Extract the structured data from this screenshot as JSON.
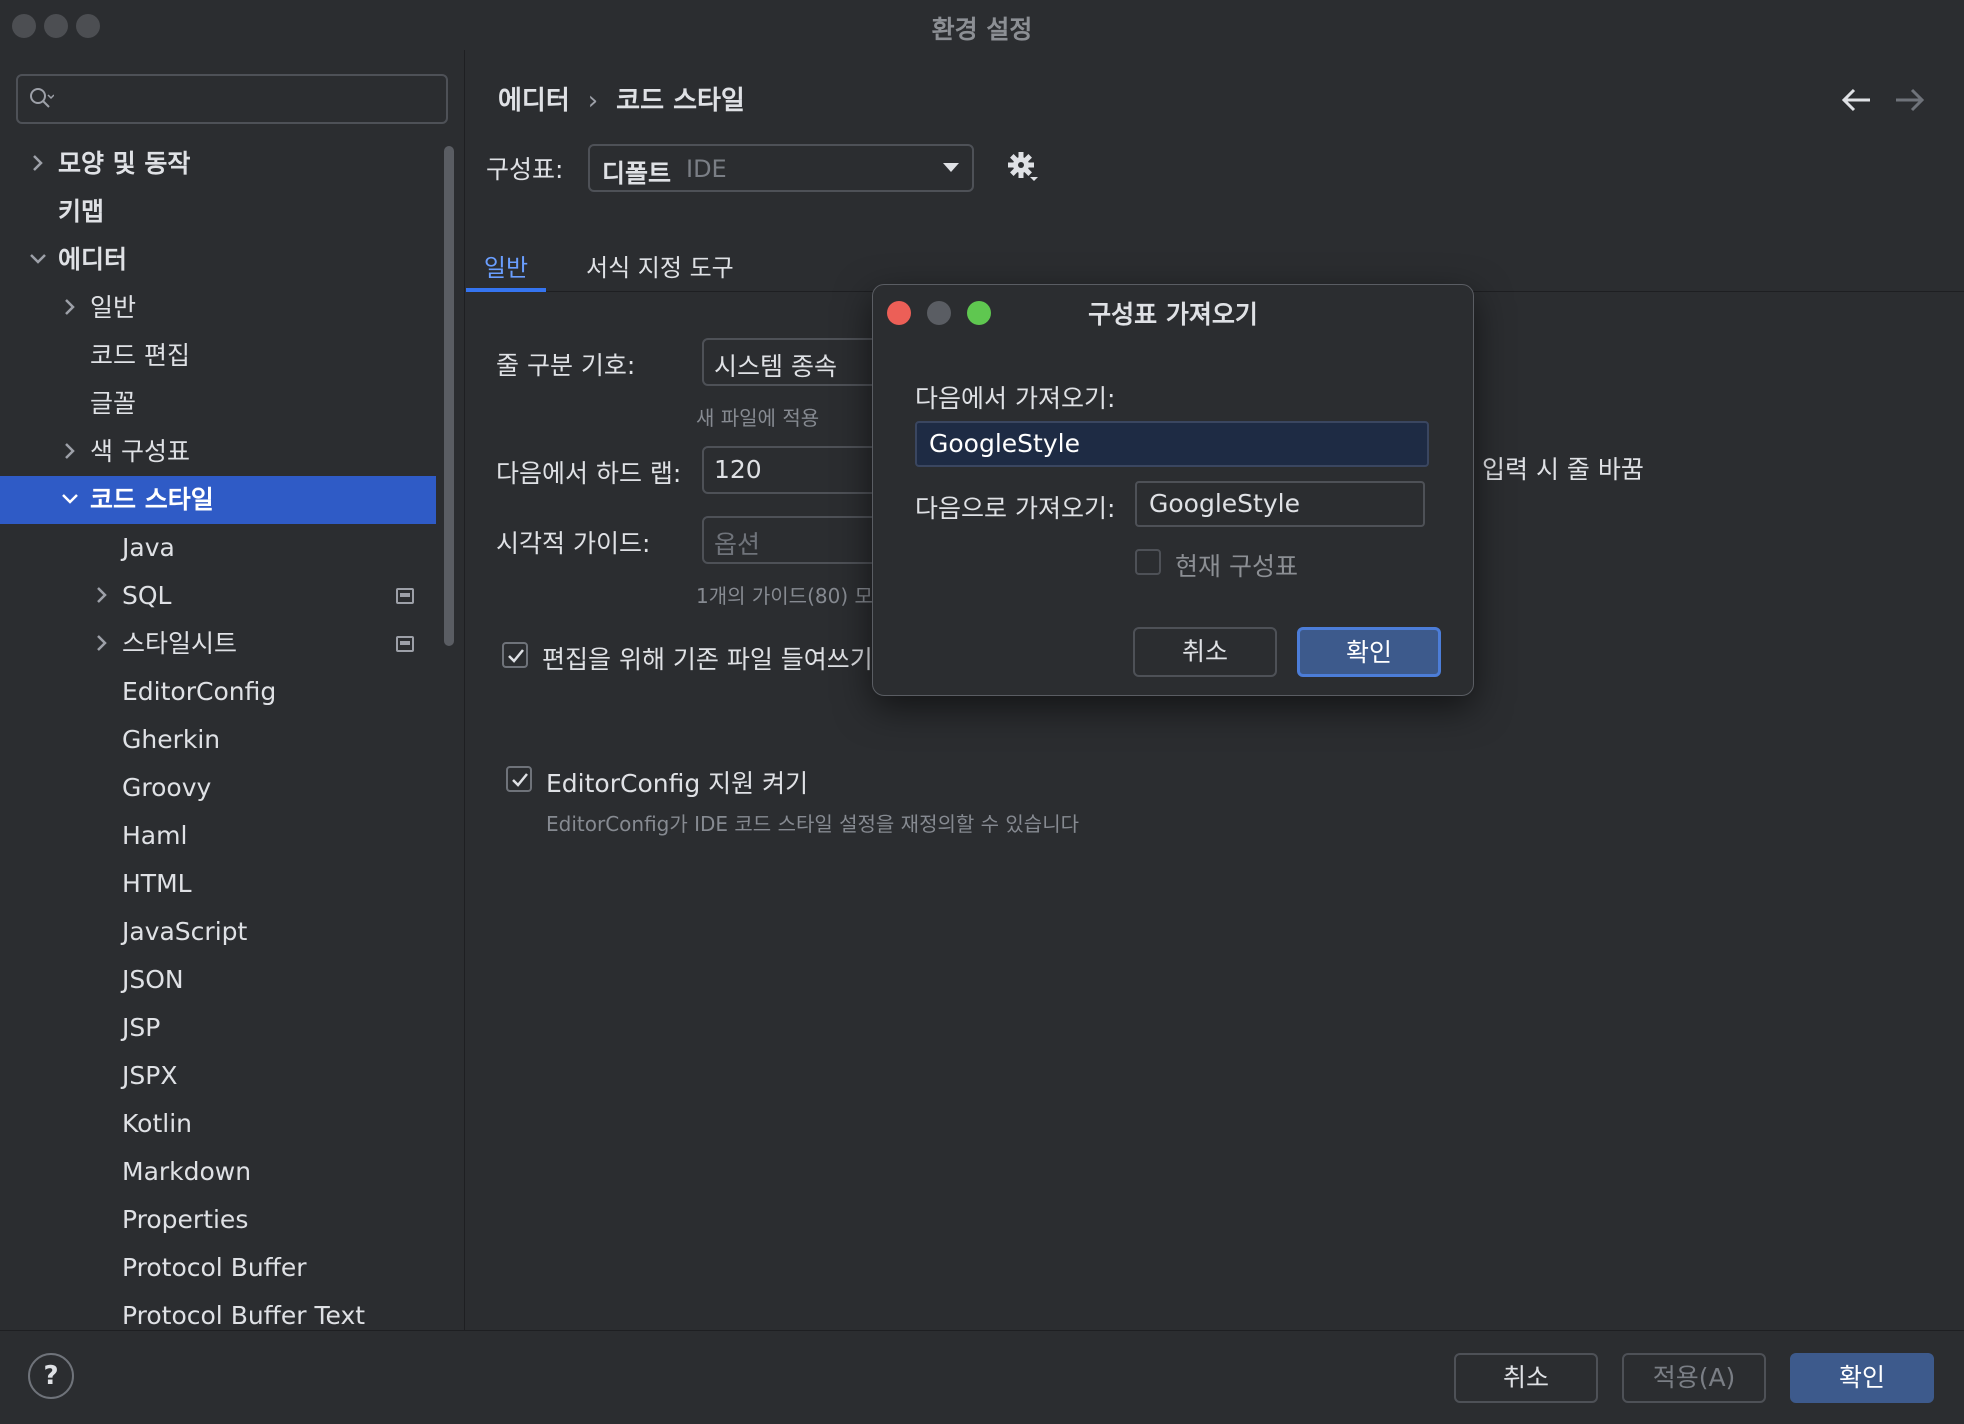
{
  "window": {
    "title": "환경 설정"
  },
  "sidebar": {
    "search": {
      "placeholder": ""
    },
    "items": [
      {
        "label": "모양 및 동작",
        "level": 0,
        "chevron": "right",
        "bold": true
      },
      {
        "label": "키맵",
        "level": 0,
        "chevron": "none",
        "bold": true
      },
      {
        "label": "에디터",
        "level": 0,
        "chevron": "down",
        "bold": true
      },
      {
        "label": "일반",
        "level": 1,
        "chevron": "right"
      },
      {
        "label": "코드 편집",
        "level": 1,
        "chevron": "none"
      },
      {
        "label": "글꼴",
        "level": 1,
        "chevron": "none"
      },
      {
        "label": "색 구성표",
        "level": 1,
        "chevron": "right"
      },
      {
        "label": "코드 스타일",
        "level": 1,
        "chevron": "down",
        "selected": true
      },
      {
        "label": "Java",
        "level": 2,
        "chevron": "none"
      },
      {
        "label": "SQL",
        "level": 2,
        "chevron": "right",
        "project_icon": true
      },
      {
        "label": "스타일시트",
        "level": 2,
        "chevron": "right",
        "project_icon": true
      },
      {
        "label": "EditorConfig",
        "level": 2,
        "chevron": "none"
      },
      {
        "label": "Gherkin",
        "level": 2,
        "chevron": "none"
      },
      {
        "label": "Groovy",
        "level": 2,
        "chevron": "none"
      },
      {
        "label": "Haml",
        "level": 2,
        "chevron": "none"
      },
      {
        "label": "HTML",
        "level": 2,
        "chevron": "none"
      },
      {
        "label": "JavaScript",
        "level": 2,
        "chevron": "none"
      },
      {
        "label": "JSON",
        "level": 2,
        "chevron": "none"
      },
      {
        "label": "JSP",
        "level": 2,
        "chevron": "none"
      },
      {
        "label": "JSPX",
        "level": 2,
        "chevron": "none"
      },
      {
        "label": "Kotlin",
        "level": 2,
        "chevron": "none"
      },
      {
        "label": "Markdown",
        "level": 2,
        "chevron": "none"
      },
      {
        "label": "Properties",
        "level": 2,
        "chevron": "none"
      },
      {
        "label": "Protocol Buffer",
        "level": 2,
        "chevron": "none"
      },
      {
        "label": "Protocol Buffer Text",
        "level": 2,
        "chevron": "none"
      }
    ]
  },
  "main": {
    "breadcrumb": {
      "parent": "에디터",
      "separator": "›",
      "current": "코드 스타일"
    },
    "scheme": {
      "label": "구성표:",
      "value": "디폴트",
      "sub": "IDE"
    },
    "tabs": [
      {
        "label": "일반",
        "active": true
      },
      {
        "label": "서식 지정 도구",
        "active": false
      }
    ],
    "line_separator": {
      "label": "줄 구분 기호:",
      "value": "시스템 종속",
      "hint": "새 파일에 적용"
    },
    "hard_wrap": {
      "label": "다음에서 하드 랩:",
      "value": "120",
      "extra": "입력 시 줄 바꿈"
    },
    "visual_guides": {
      "label": "시각적 가이드:",
      "placeholder": "옵션",
      "hint": "1개의 가이드(80) 모"
    },
    "detect_indent": {
      "label": "편집을 위해 기존 파일 들여쓰기",
      "checked": true
    },
    "editorconfig": {
      "label": "EditorConfig 지원 켜기",
      "checked": true,
      "hint": "EditorConfig가 IDE 코드 스타일 설정을 재정의할 수 있습니다"
    }
  },
  "dialog": {
    "title": "구성표 가져오기",
    "from_label": "다음에서 가져오기:",
    "from_value": "GoogleStyle",
    "to_label": "다음으로 가져오기:",
    "to_value": "GoogleStyle",
    "current_scheme_label": "현재 구성표",
    "current_scheme_checked": false,
    "cancel": "취소",
    "ok": "확인"
  },
  "footer": {
    "help": "?",
    "cancel": "취소",
    "apply": "적용(A)",
    "ok": "확인"
  },
  "colors": {
    "accent": "#3574f0",
    "selection": "#2f5bc6",
    "primary_button": "#3d5a8c",
    "close_red": "#ec5f57",
    "zoom_green": "#5fc750",
    "background": "#2b2d30"
  }
}
